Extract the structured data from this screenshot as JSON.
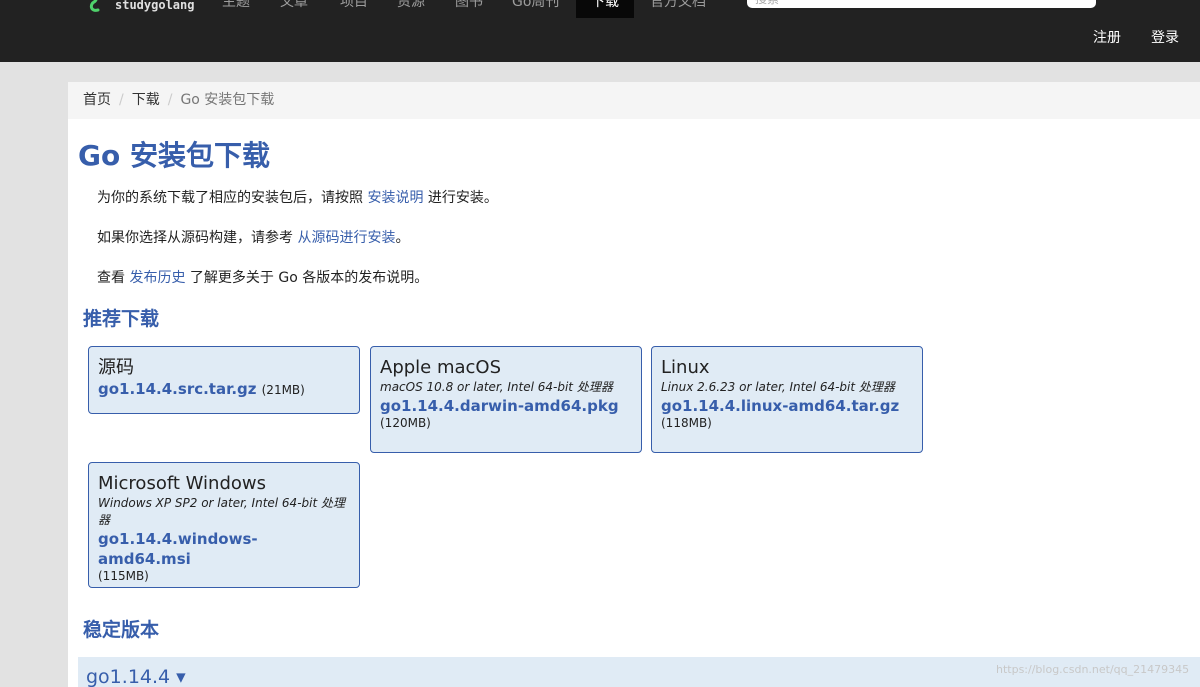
{
  "header": {
    "logo_text": "studygolang",
    "nav": [
      {
        "label": "主题"
      },
      {
        "label": "文章"
      },
      {
        "label": "项目"
      },
      {
        "label": "资源"
      },
      {
        "label": "图书"
      },
      {
        "label": "Go周刊"
      },
      {
        "label": "下载"
      },
      {
        "label": "官方文档"
      }
    ],
    "search_placeholder": "搜索",
    "register_label": "注册",
    "login_label": "登录"
  },
  "breadcrumb": {
    "home": "首页",
    "downloads": "下载",
    "current": "Go 安装包下载",
    "separator": "/"
  },
  "page": {
    "title": "Go 安装包下载",
    "para1_before": "为你的系统下载了相应的安装包后，请按照 ",
    "para1_link": "安装说明",
    "para1_after": " 进行安装。",
    "para2_before": "如果你选择从源码构建，请参考 ",
    "para2_link": "从源码进行安装",
    "para2_after": "。",
    "para3_before": "查看 ",
    "para3_link": "发布历史",
    "para3_after": " 了解更多关于 Go 各版本的发布说明。",
    "recommended_title": "推荐下载",
    "stable_title": "稳定版本",
    "stable_version": "go1.14.4 ▾"
  },
  "downloads": [
    {
      "os": "源码",
      "note": "",
      "file": "go1.14.4.src.tar.gz",
      "size": "(21MB)"
    },
    {
      "os": "Apple macOS",
      "note": "macOS 10.8 or later, Intel 64-bit 处理器",
      "file": "go1.14.4.darwin-amd64.pkg",
      "size": "(120MB)"
    },
    {
      "os": "Linux",
      "note": "Linux 2.6.23 or later, Intel 64-bit 处理器",
      "file": "go1.14.4.linux-amd64.tar.gz",
      "size": "(118MB)"
    },
    {
      "os": "Microsoft Windows",
      "note": "Windows XP SP2 or later, Intel 64-bit 处理器",
      "file": "go1.14.4.windows-amd64.msi",
      "size": "(115MB)"
    }
  ],
  "watermark": "https://blog.csdn.net/qq_21479345"
}
